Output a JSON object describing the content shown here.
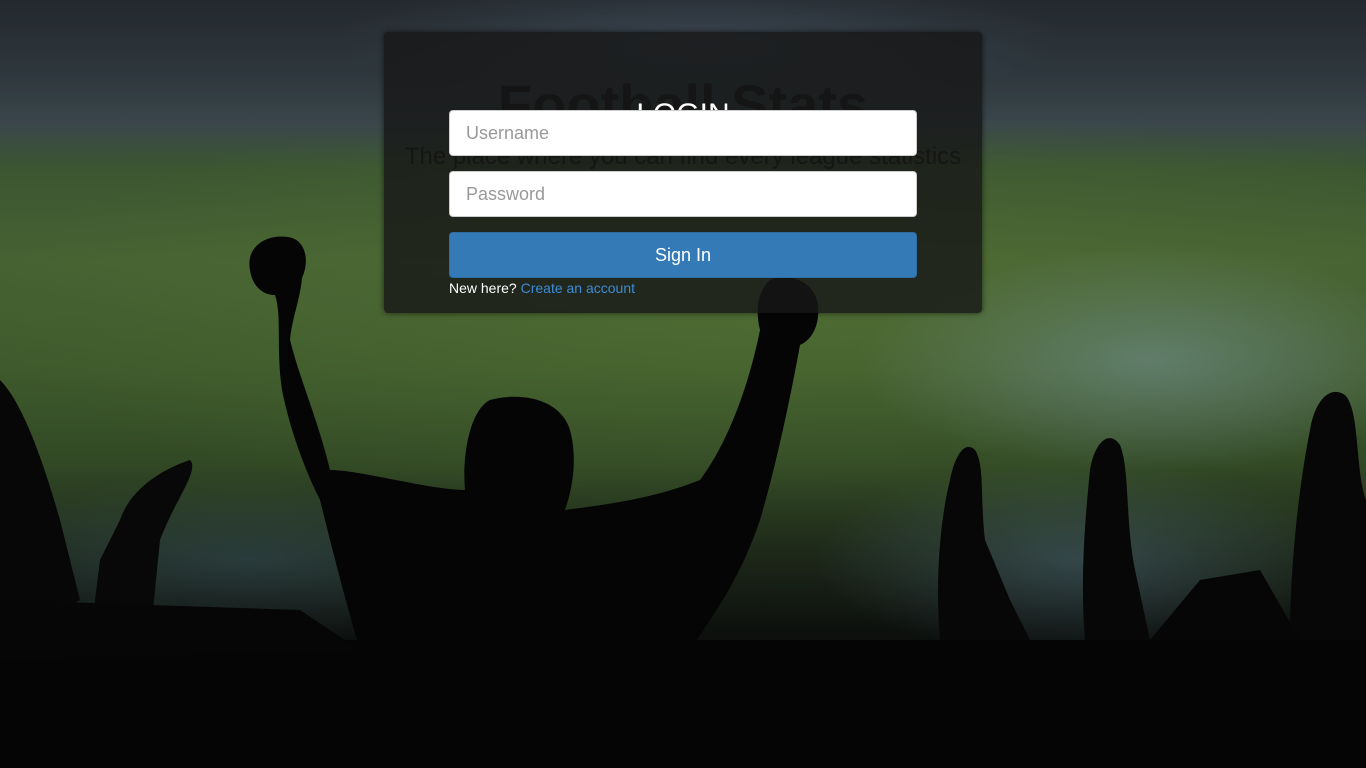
{
  "hero": {
    "title": "Football Stats",
    "subtitle": "The place where you can find every league statistics"
  },
  "login": {
    "heading": "LOGIN",
    "username_placeholder": "Username",
    "password_placeholder": "Password",
    "sign_in_label": "Sign In",
    "new_here_text": "New here?",
    "create_account_link": "Create an account"
  },
  "colors": {
    "primary_button": "#337ab7",
    "link": "#3c8bd6",
    "card_background": "rgba(22,22,22,0.80)"
  }
}
